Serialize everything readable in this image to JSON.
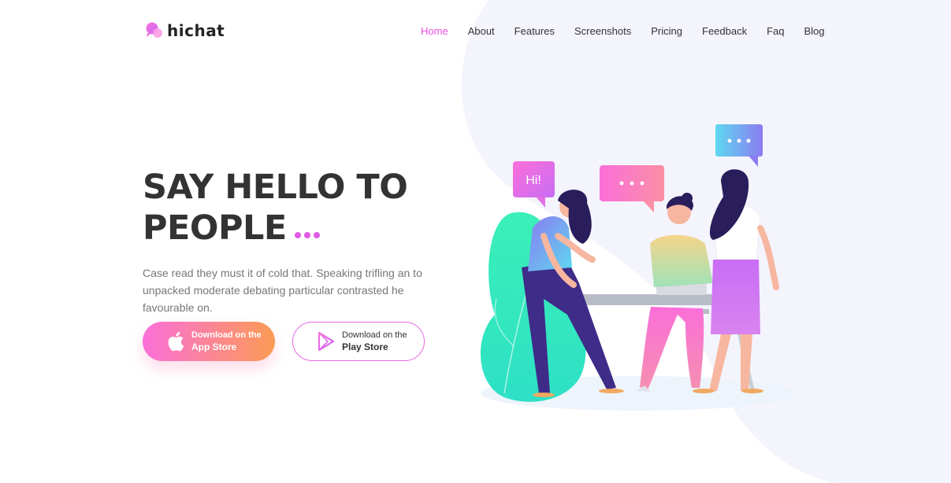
{
  "brand": {
    "name": "hichat"
  },
  "nav": {
    "items": [
      {
        "label": "Home",
        "active": true
      },
      {
        "label": "About"
      },
      {
        "label": "Features"
      },
      {
        "label": "Screenshots"
      },
      {
        "label": "Pricing"
      },
      {
        "label": "Feedback"
      },
      {
        "label": "Faq"
      },
      {
        "label": "Blog"
      }
    ]
  },
  "hero": {
    "headline_line1": "SAY HELLO TO",
    "headline_line2": "PEOPLE",
    "description": "Case read they must it of cold that. Speaking trifling an to unpacked moderate debating particular contrasted he favourable on."
  },
  "buttons": {
    "app_store": {
      "small": "Download on the",
      "big": "App Store",
      "icon": "apple-icon"
    },
    "play_store": {
      "small": "Download on the",
      "big": "Play Store",
      "icon": "play-store-icon"
    }
  },
  "illustration": {
    "bubble_hi": "Hi!"
  },
  "colors": {
    "accent": "#e94ee2",
    "blob": "#f4f4fd",
    "gradient_start": "#fb6fd9",
    "gradient_end": "#fb9b54"
  }
}
